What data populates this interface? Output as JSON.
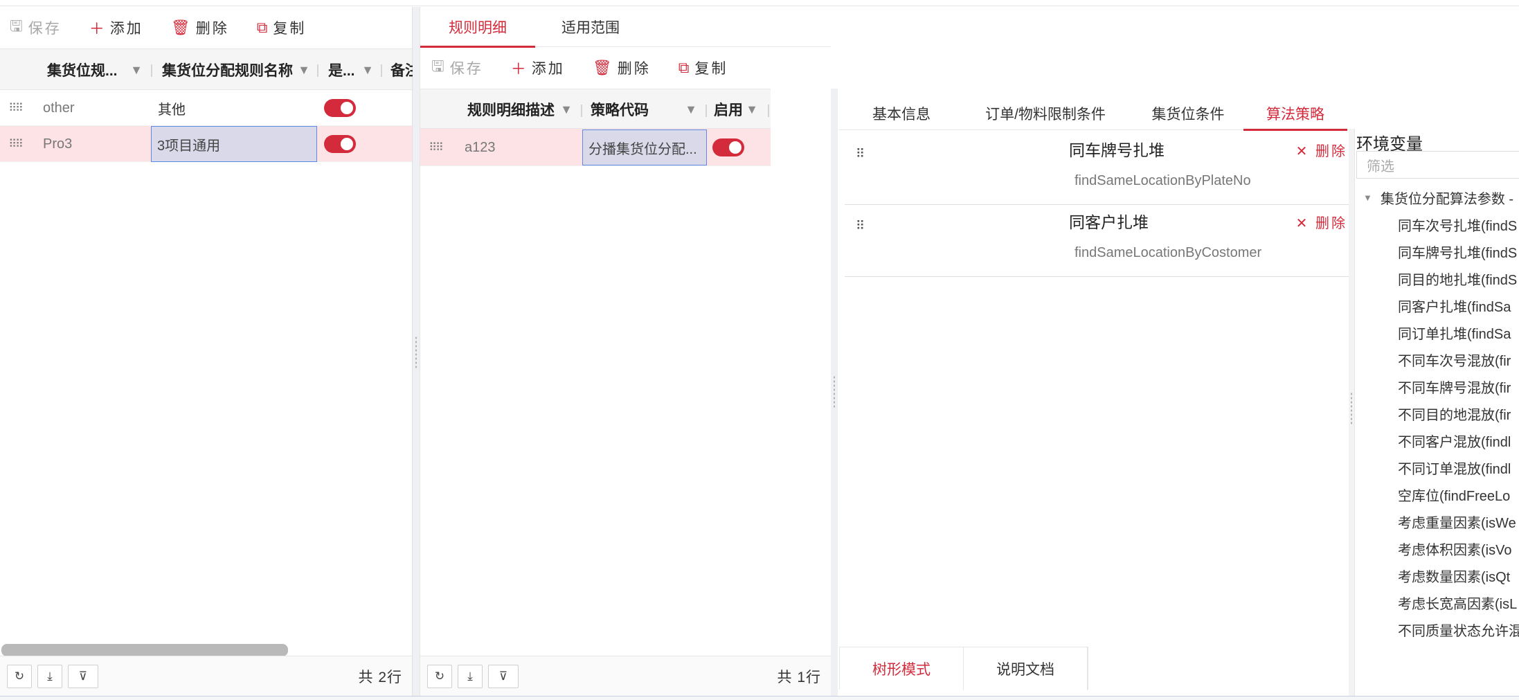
{
  "toolbar": {
    "save": "保存",
    "add": "添加",
    "delete": "删除",
    "copy": "复制"
  },
  "icons": {
    "save": "save-icon",
    "add": "plus-icon",
    "delete": "trash-icon",
    "copy": "copy-icon",
    "filter": "funnel-icon",
    "drag": "drag-handle-icon",
    "refresh": "refresh-icon",
    "export": "export-icon",
    "filter_clear": "filter-icon",
    "caret": "caret-down-icon"
  },
  "colors": {
    "accent": "#d42b3c",
    "selected_row": "#fde3e5",
    "editing_cell": "#d9d9ea"
  },
  "rules_grid": {
    "columns": [
      "集货位规...",
      "集货位分配规则名称",
      "是...",
      "备注"
    ],
    "rows": [
      {
        "code": "other",
        "name": "其他",
        "enabled": true
      },
      {
        "code": "Pro3",
        "name": "3项目通用",
        "enabled": true
      }
    ],
    "total": "共 2行"
  },
  "main_tabs": [
    "规则明细",
    "适用范围"
  ],
  "detail_grid": {
    "columns": [
      "规则明细描述",
      "策略代码",
      "启用"
    ],
    "rows": [
      {
        "desc": "a123",
        "strategy": "分播集货位分配...",
        "enabled": true
      }
    ],
    "total": "共 1行"
  },
  "sub_tabs": [
    "基本信息",
    "订单/物料限制条件",
    "集货位条件",
    "算法策略"
  ],
  "algorithms": [
    {
      "title": "同车牌号扎堆",
      "code": "findSameLocationByPlateNo",
      "delete": "删除"
    },
    {
      "title": "同客户扎堆",
      "code": "findSameLocationByCostomer",
      "delete": "删除"
    }
  ],
  "bottom_tabs": [
    "树形模式",
    "说明文档"
  ],
  "env": {
    "title": "环境变量",
    "filter_placeholder": "筛选",
    "root": "集货位分配算法参数 -",
    "items": [
      "同车次号扎堆(findS",
      "同车牌号扎堆(findS",
      "同目的地扎堆(findS",
      "同客户扎堆(findSa",
      "同订单扎堆(findSa",
      "不同车次号混放(fir",
      "不同车牌号混放(fir",
      "不同目的地混放(fir",
      "不同客户混放(findl",
      "不同订单混放(findl",
      "空库位(findFreeLo",
      "考虑重量因素(isWe",
      "考虑体积因素(isVo",
      "考虑数量因素(isQt",
      "考虑长宽高因素(isL",
      "不同质量状态允许混"
    ]
  }
}
